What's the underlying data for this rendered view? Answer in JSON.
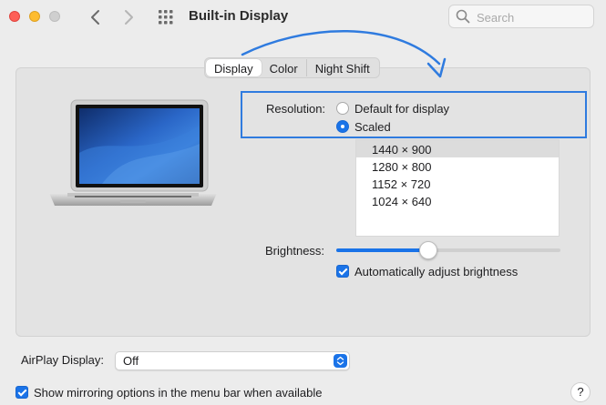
{
  "window": {
    "title": "Built-in Display",
    "search_placeholder": "Search"
  },
  "toolbar": {
    "back_icon": "chevron-left-icon",
    "forward_icon": "chevron-right-icon",
    "grid_icon": "show-all-grid-icon",
    "search_icon": "magnifier-icon"
  },
  "tabs": [
    {
      "label": "Display",
      "active": true
    },
    {
      "label": "Color",
      "active": false
    },
    {
      "label": "Night Shift",
      "active": false
    }
  ],
  "resolution": {
    "label": "Resolution:",
    "options": [
      {
        "label": "Default for display",
        "selected": false
      },
      {
        "label": "Scaled",
        "selected": true
      }
    ],
    "scaled_list": [
      {
        "label": "1440 × 900",
        "selected": true
      },
      {
        "label": "1280 × 800",
        "selected": false
      },
      {
        "label": "1152 × 720",
        "selected": false
      },
      {
        "label": "1024 × 640",
        "selected": false
      }
    ]
  },
  "brightness": {
    "label": "Brightness:",
    "level_fraction": 0.41,
    "auto_label": "Automatically adjust brightness",
    "auto_checked": true
  },
  "airplay": {
    "label": "AirPlay Display:",
    "value": "Off"
  },
  "mirroring": {
    "label": "Show mirroring options in the menu bar when available",
    "checked": true
  },
  "help": {
    "label": "?"
  },
  "colors": {
    "accent": "#1a73e8",
    "annotation": "#2f7bdf",
    "close": "#fe5f57",
    "minimize": "#febc2e"
  }
}
